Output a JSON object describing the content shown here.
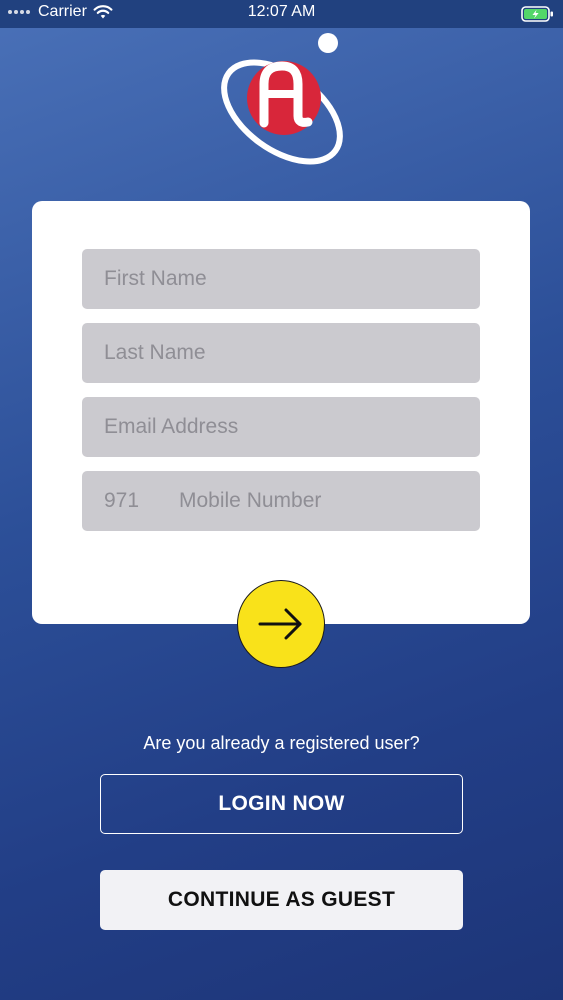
{
  "status_bar": {
    "carrier": "Carrier",
    "time": "12:07 AM"
  },
  "form": {
    "first_name_placeholder": "First Name",
    "last_name_placeholder": "Last Name",
    "email_placeholder": "Email Address",
    "country_code": "971",
    "mobile_placeholder": "Mobile Number"
  },
  "registered_question": "Are you already a registered user?",
  "login_label": "LOGIN NOW",
  "guest_label": "CONTINUE AS GUEST",
  "colors": {
    "accent_yellow": "#f9e21a",
    "logo_red": "#d8263a",
    "background_blue": "#2c4f98"
  },
  "icons": [
    "signal-dots-icon",
    "wifi-icon",
    "battery-charging-icon",
    "app-logo",
    "arrow-right-icon"
  ]
}
